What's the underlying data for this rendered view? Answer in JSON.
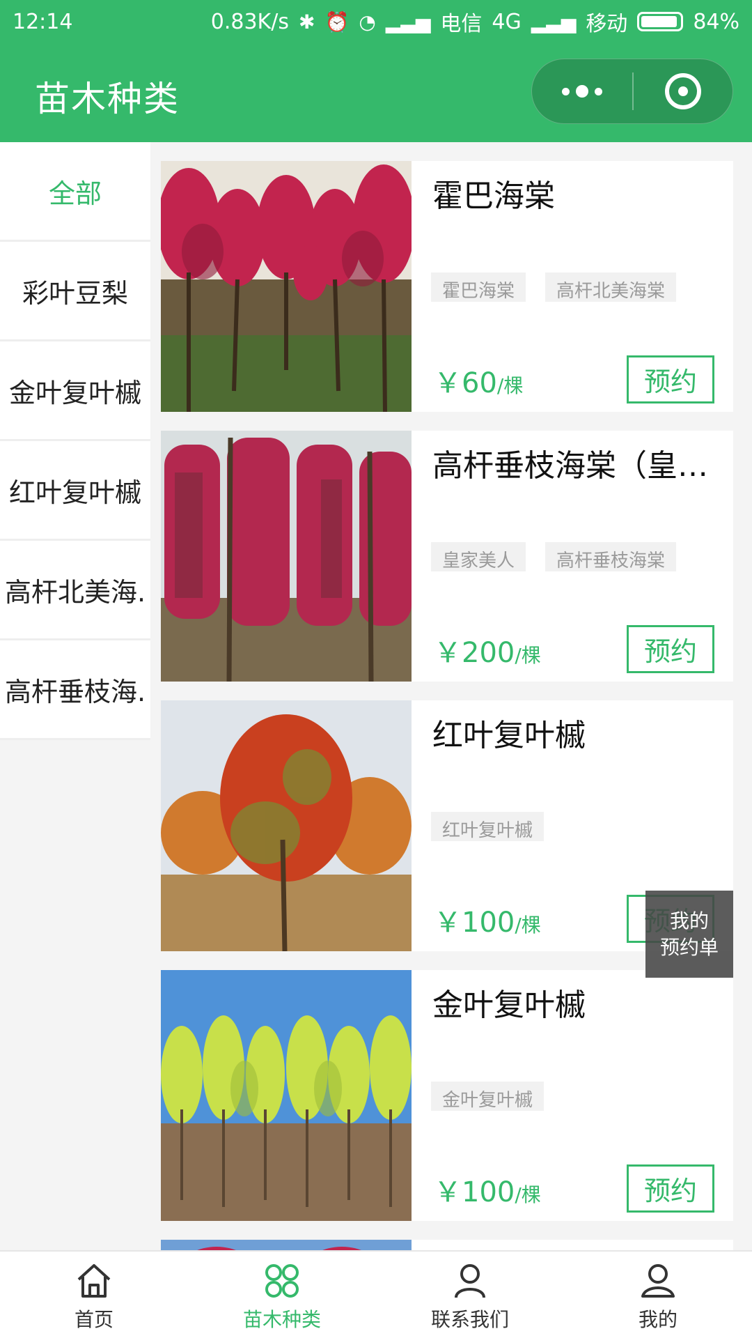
{
  "status_bar": {
    "time": "12:14",
    "net_speed": "0.83K/s",
    "carrier1": "电信",
    "network": "4G",
    "carrier2": "移动",
    "battery": "84%"
  },
  "nav": {
    "title": "苗木种类"
  },
  "colors": {
    "brand": "#35b96b"
  },
  "sidebar": {
    "items": [
      {
        "label": "全部",
        "active": true
      },
      {
        "label": "彩叶豆梨"
      },
      {
        "label": "金叶复叶槭"
      },
      {
        "label": "红叶复叶槭"
      },
      {
        "label": "高杆北美海."
      },
      {
        "label": "高杆垂枝海."
      }
    ]
  },
  "products": [
    {
      "title": "霍巴海棠",
      "tags": [
        "霍巴海棠",
        "高杆北美海棠"
      ],
      "price": "￥60",
      "unit": "/棵",
      "button": "预约"
    },
    {
      "title": "高杆垂枝海棠（皇家美人）",
      "tags": [
        "皇家美人",
        "高杆垂枝海棠"
      ],
      "price": "￥200",
      "unit": "/棵",
      "button": "预约"
    },
    {
      "title": "红叶复叶槭",
      "tags": [
        "红叶复叶槭"
      ],
      "price": "￥100",
      "unit": "/棵",
      "button": "预约"
    },
    {
      "title": "金叶复叶槭",
      "tags": [
        "金叶复叶槭"
      ],
      "price": "￥100",
      "unit": "/棵",
      "button": "预约"
    }
  ],
  "floating": {
    "line1": "我的",
    "line2": "预约单"
  },
  "tabbar": {
    "items": [
      {
        "label": "首页",
        "icon": "home-icon"
      },
      {
        "label": "苗木种类",
        "icon": "category-icon",
        "active": true
      },
      {
        "label": "联系我们",
        "icon": "person-icon"
      },
      {
        "label": "我的",
        "icon": "profile-icon"
      }
    ]
  }
}
